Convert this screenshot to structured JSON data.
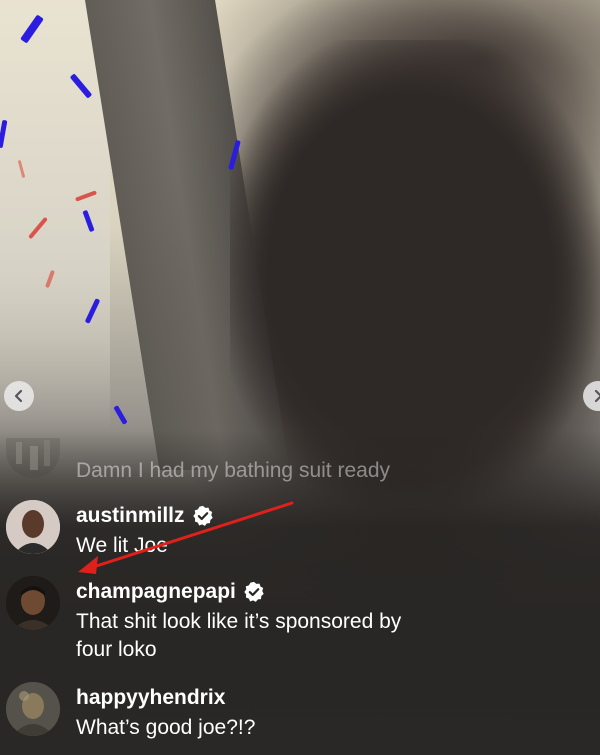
{
  "comments": [
    {
      "username": "",
      "text": "Damn I had my bathing suit ready"
    },
    {
      "username": "austinmillz",
      "text": "We lit Joe",
      "verified": true
    },
    {
      "username": "champagnepapi",
      "text_line1": "That shit look like it’s sponsored by",
      "text_line2": "four loko",
      "verified": true
    },
    {
      "username": "happyyhendrix",
      "text": "What’s good joe?!?"
    }
  ],
  "colors": {
    "annotation_arrow": "#e0211b",
    "confetti_blue": "#2a1de0",
    "confetti_red": "#d9544a"
  },
  "icons": {
    "left_nav": "chevron-left-icon",
    "right_nav": "chevron-right-icon",
    "verified": "verified-badge-icon"
  }
}
